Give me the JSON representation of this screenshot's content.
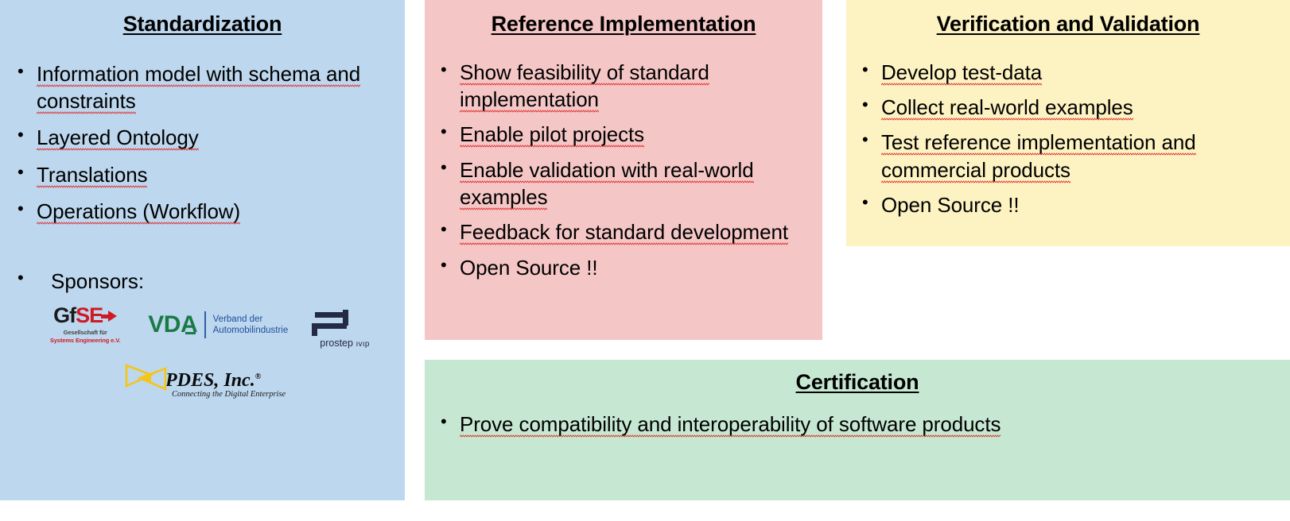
{
  "slide": {
    "panels": [
      {
        "id": "standardization",
        "title": "Standardization",
        "color": "#bdd7ee",
        "bullets": [
          "Information model with schema and constraints",
          "Layered Ontology",
          "Translations",
          "Operations (Workflow)"
        ],
        "sponsors_label": "Sponsors:",
        "sponsors": [
          {
            "name": "gfse",
            "word_dark": "Gf",
            "word_red": "SE",
            "subtitle_line1": "Gesellschaft für",
            "subtitle_line2": "Systems Engineering e.V.",
            "color_dark": "#1a1a1a",
            "color_red": "#d01a22"
          },
          {
            "name": "vda",
            "word": "VDA",
            "subtitle_line1": "Verband der",
            "subtitle_line2": "Automobilindustrie",
            "color_word": "#1a7a46",
            "color_subtitle": "#1f4e9c"
          },
          {
            "name": "prostep-ivip",
            "word": "prostep",
            "word_small": "ıvıp",
            "color": "#232a44"
          },
          {
            "name": "pdes-inc",
            "word": "PDES, Inc.",
            "registered": "®",
            "tagline": "Connecting the Digital Enterprise",
            "color_mark": "#f5c518"
          }
        ]
      },
      {
        "id": "reference",
        "title": "Reference Implementation",
        "color": "#f5c6c6",
        "bullets": [
          "Show feasibility of standard implementation",
          "Enable pilot projects",
          "Enable validation with real-world examples",
          "Feedback for standard development",
          "Open Source !!"
        ]
      },
      {
        "id": "verification",
        "title": "Verification and Validation",
        "color": "#fcf2c2",
        "bullets": [
          "Develop test-data",
          "Collect real-world examples",
          "Test reference implementation and commercial products",
          "Open Source !!"
        ]
      },
      {
        "id": "certification",
        "title": "Certification",
        "color": "#c6e8d2",
        "bullets": [
          "Prove compatibility and interoperability of software products"
        ]
      }
    ]
  }
}
